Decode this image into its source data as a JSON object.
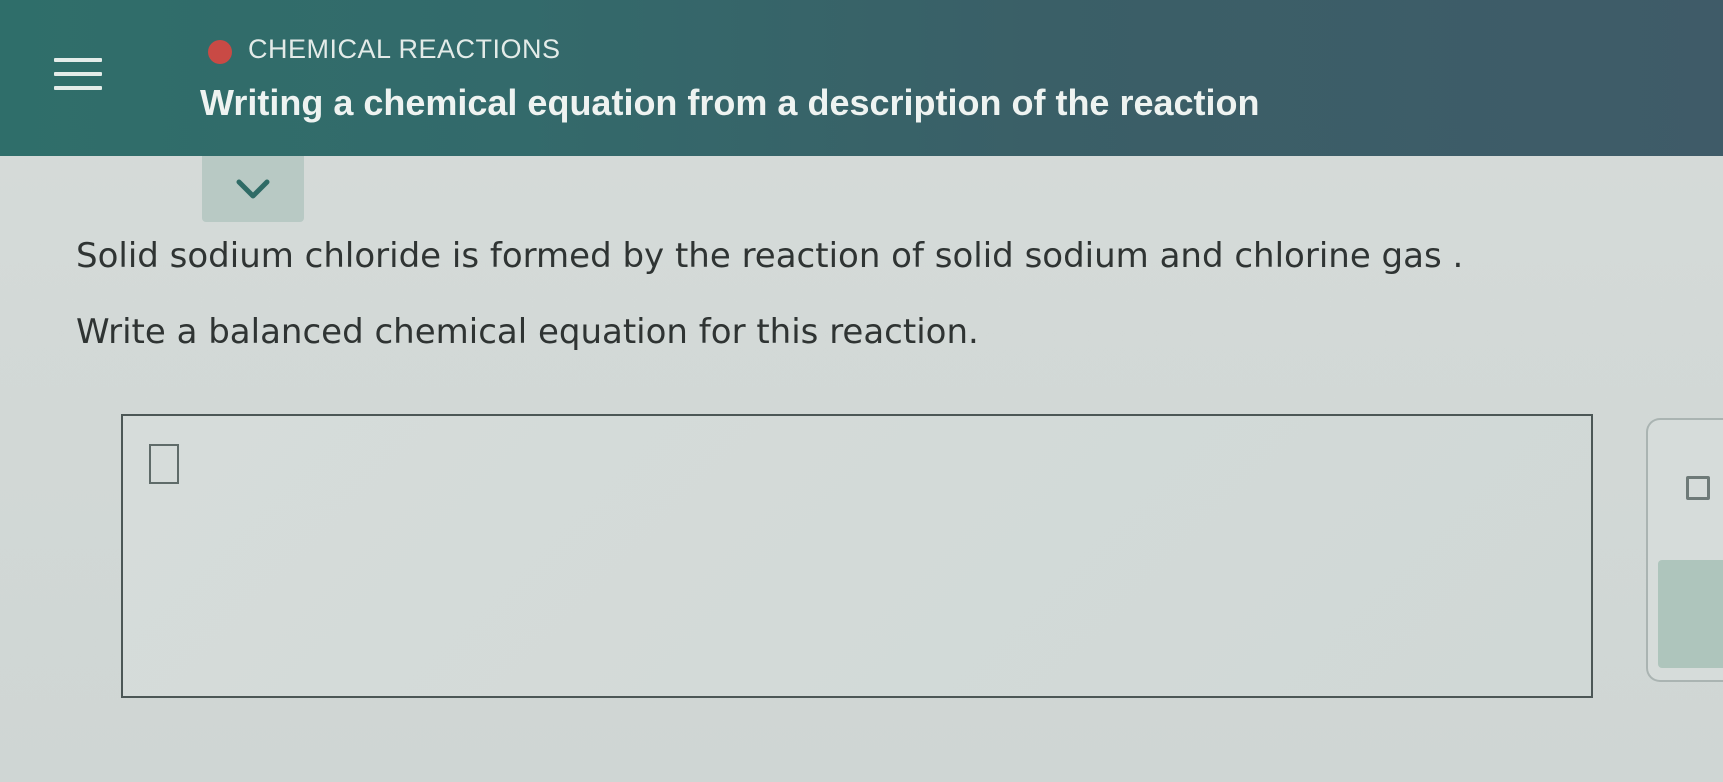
{
  "header": {
    "category": "CHEMICAL REACTIONS",
    "title": "Writing a chemical equation from a description of the reaction",
    "icons": {
      "menu": "menu-icon",
      "category_status": "status-dot-icon",
      "expand": "chevron-down-icon"
    },
    "colors": {
      "header_bg": "#336a6b",
      "category_dot": "#c94a45"
    }
  },
  "problem": {
    "statement": "Solid sodium chloride is formed by the reaction of solid sodium and chlorine gas .",
    "instruction": "Write a balanced chemical equation for this reaction."
  },
  "answer": {
    "value": ""
  },
  "tools": {
    "icons": [
      "superscript-box-icon"
    ]
  }
}
